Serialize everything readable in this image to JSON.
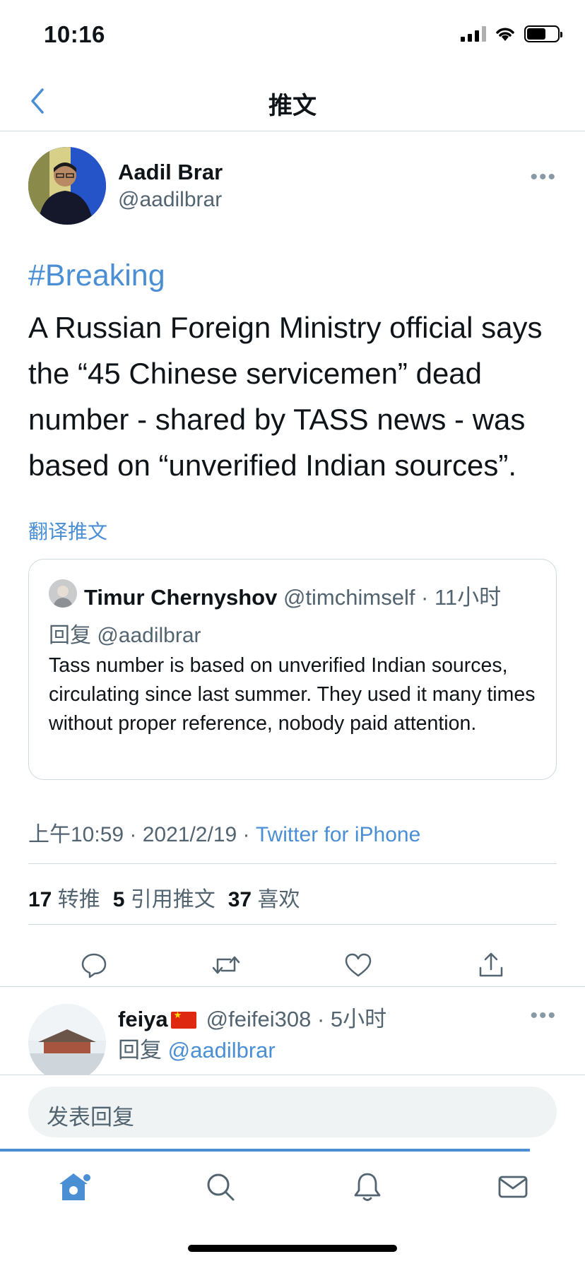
{
  "status_bar": {
    "time": "10:16"
  },
  "nav": {
    "title": "推文",
    "back_icon": "chevron-left-icon"
  },
  "tweet": {
    "author_name": "Aadil Brar",
    "author_handle": "@aadilbrar",
    "hashtag": "#Breaking",
    "body": "A Russian Foreign Ministry official says the “45 Chinese servicemen” dead number - shared by TASS news - was based on “unverified Indian sources”.",
    "translate_label": "翻译推文",
    "quote": {
      "name": "Timur Chernyshov",
      "meta": "@timchimself · 11小时",
      "reply_to": "回复 @aadilbrar",
      "text": "Tass number is based on unverified Indian sources, circulating since last summer. They used it many times without proper reference, nobody paid attention."
    },
    "timestamp": "上午10:59 · 2021/2/19 · ",
    "source": "Twitter for iPhone",
    "stats": [
      {
        "count": "17",
        "label": "转推"
      },
      {
        "count": "5",
        "label": "引用推文"
      },
      {
        "count": "37",
        "label": "喜欢"
      }
    ],
    "actions": [
      "reply-icon",
      "retweet-icon",
      "like-icon",
      "share-icon"
    ]
  },
  "reply": {
    "name": "feiya",
    "meta": "@feifei308 · 5小时",
    "reply_prefix": "回复",
    "reply_handle": "@aadilbrar"
  },
  "compose": {
    "placeholder": "发表回复"
  },
  "tab_bar": {
    "items": [
      "home-icon",
      "search-icon",
      "notifications-icon",
      "messages-icon"
    ],
    "active": "home-icon"
  },
  "colors": {
    "accent": "#4a8fd4",
    "text": "#0f1419",
    "secondary": "#536471",
    "border": "#cfd9de"
  }
}
